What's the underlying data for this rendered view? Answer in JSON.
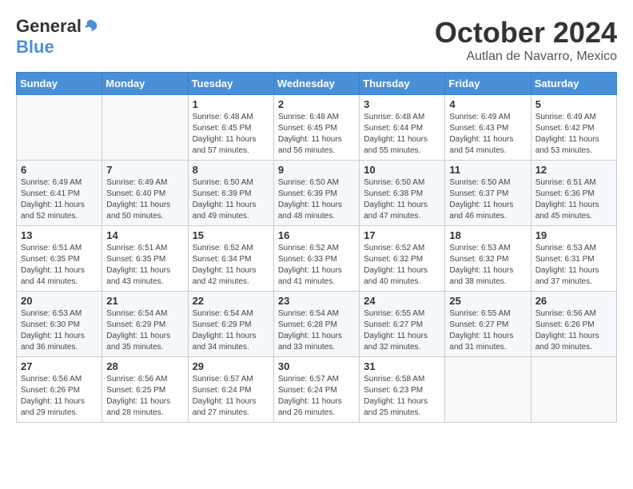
{
  "logo": {
    "general": "General",
    "blue": "Blue"
  },
  "title": "October 2024",
  "subtitle": "Autlan de Navarro, Mexico",
  "days_header": [
    "Sunday",
    "Monday",
    "Tuesday",
    "Wednesday",
    "Thursday",
    "Friday",
    "Saturday"
  ],
  "weeks": [
    [
      {
        "day": "",
        "info": ""
      },
      {
        "day": "",
        "info": ""
      },
      {
        "day": "1",
        "info": "Sunrise: 6:48 AM\nSunset: 6:45 PM\nDaylight: 11 hours and 57 minutes."
      },
      {
        "day": "2",
        "info": "Sunrise: 6:48 AM\nSunset: 6:45 PM\nDaylight: 11 hours and 56 minutes."
      },
      {
        "day": "3",
        "info": "Sunrise: 6:48 AM\nSunset: 6:44 PM\nDaylight: 11 hours and 55 minutes."
      },
      {
        "day": "4",
        "info": "Sunrise: 6:49 AM\nSunset: 6:43 PM\nDaylight: 11 hours and 54 minutes."
      },
      {
        "day": "5",
        "info": "Sunrise: 6:49 AM\nSunset: 6:42 PM\nDaylight: 11 hours and 53 minutes."
      }
    ],
    [
      {
        "day": "6",
        "info": "Sunrise: 6:49 AM\nSunset: 6:41 PM\nDaylight: 11 hours and 52 minutes."
      },
      {
        "day": "7",
        "info": "Sunrise: 6:49 AM\nSunset: 6:40 PM\nDaylight: 11 hours and 50 minutes."
      },
      {
        "day": "8",
        "info": "Sunrise: 6:50 AM\nSunset: 6:39 PM\nDaylight: 11 hours and 49 minutes."
      },
      {
        "day": "9",
        "info": "Sunrise: 6:50 AM\nSunset: 6:39 PM\nDaylight: 11 hours and 48 minutes."
      },
      {
        "day": "10",
        "info": "Sunrise: 6:50 AM\nSunset: 6:38 PM\nDaylight: 11 hours and 47 minutes."
      },
      {
        "day": "11",
        "info": "Sunrise: 6:50 AM\nSunset: 6:37 PM\nDaylight: 11 hours and 46 minutes."
      },
      {
        "day": "12",
        "info": "Sunrise: 6:51 AM\nSunset: 6:36 PM\nDaylight: 11 hours and 45 minutes."
      }
    ],
    [
      {
        "day": "13",
        "info": "Sunrise: 6:51 AM\nSunset: 6:35 PM\nDaylight: 11 hours and 44 minutes."
      },
      {
        "day": "14",
        "info": "Sunrise: 6:51 AM\nSunset: 6:35 PM\nDaylight: 11 hours and 43 minutes."
      },
      {
        "day": "15",
        "info": "Sunrise: 6:52 AM\nSunset: 6:34 PM\nDaylight: 11 hours and 42 minutes."
      },
      {
        "day": "16",
        "info": "Sunrise: 6:52 AM\nSunset: 6:33 PM\nDaylight: 11 hours and 41 minutes."
      },
      {
        "day": "17",
        "info": "Sunrise: 6:52 AM\nSunset: 6:32 PM\nDaylight: 11 hours and 40 minutes."
      },
      {
        "day": "18",
        "info": "Sunrise: 6:53 AM\nSunset: 6:32 PM\nDaylight: 11 hours and 38 minutes."
      },
      {
        "day": "19",
        "info": "Sunrise: 6:53 AM\nSunset: 6:31 PM\nDaylight: 11 hours and 37 minutes."
      }
    ],
    [
      {
        "day": "20",
        "info": "Sunrise: 6:53 AM\nSunset: 6:30 PM\nDaylight: 11 hours and 36 minutes."
      },
      {
        "day": "21",
        "info": "Sunrise: 6:54 AM\nSunset: 6:29 PM\nDaylight: 11 hours and 35 minutes."
      },
      {
        "day": "22",
        "info": "Sunrise: 6:54 AM\nSunset: 6:29 PM\nDaylight: 11 hours and 34 minutes."
      },
      {
        "day": "23",
        "info": "Sunrise: 6:54 AM\nSunset: 6:28 PM\nDaylight: 11 hours and 33 minutes."
      },
      {
        "day": "24",
        "info": "Sunrise: 6:55 AM\nSunset: 6:27 PM\nDaylight: 11 hours and 32 minutes."
      },
      {
        "day": "25",
        "info": "Sunrise: 6:55 AM\nSunset: 6:27 PM\nDaylight: 11 hours and 31 minutes."
      },
      {
        "day": "26",
        "info": "Sunrise: 6:56 AM\nSunset: 6:26 PM\nDaylight: 11 hours and 30 minutes."
      }
    ],
    [
      {
        "day": "27",
        "info": "Sunrise: 6:56 AM\nSunset: 6:26 PM\nDaylight: 11 hours and 29 minutes."
      },
      {
        "day": "28",
        "info": "Sunrise: 6:56 AM\nSunset: 6:25 PM\nDaylight: 11 hours and 28 minutes."
      },
      {
        "day": "29",
        "info": "Sunrise: 6:57 AM\nSunset: 6:24 PM\nDaylight: 11 hours and 27 minutes."
      },
      {
        "day": "30",
        "info": "Sunrise: 6:57 AM\nSunset: 6:24 PM\nDaylight: 11 hours and 26 minutes."
      },
      {
        "day": "31",
        "info": "Sunrise: 6:58 AM\nSunset: 6:23 PM\nDaylight: 11 hours and 25 minutes."
      },
      {
        "day": "",
        "info": ""
      },
      {
        "day": "",
        "info": ""
      }
    ]
  ]
}
